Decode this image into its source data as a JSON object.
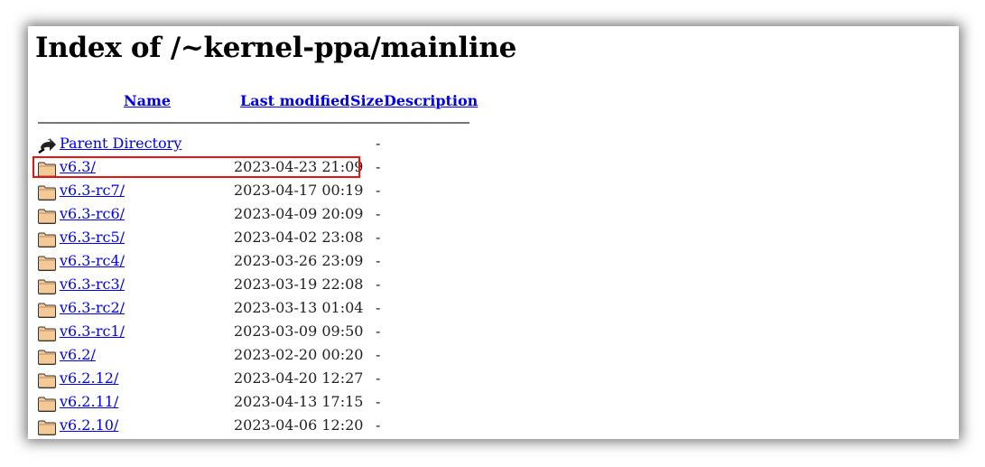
{
  "page": {
    "title": "Index of /~kernel-ppa/mainline"
  },
  "columns": {
    "name": "Name",
    "last_modified": "Last modified",
    "size": "Size",
    "description": "Description"
  },
  "parent": {
    "label": "Parent Directory",
    "size": "-",
    "icon": "back-arrow-icon"
  },
  "highlight_color": "#ee1111",
  "entries": [
    {
      "name": "v6.3/",
      "modified": "2023-04-23 21:09",
      "size": "-",
      "icon": "folder-icon",
      "highlighted": true
    },
    {
      "name": "v6.3-rc7/",
      "modified": "2023-04-17 00:19",
      "size": "-",
      "icon": "folder-icon"
    },
    {
      "name": "v6.3-rc6/",
      "modified": "2023-04-09 20:09",
      "size": "-",
      "icon": "folder-icon"
    },
    {
      "name": "v6.3-rc5/",
      "modified": "2023-04-02 23:08",
      "size": "-",
      "icon": "folder-icon"
    },
    {
      "name": "v6.3-rc4/",
      "modified": "2023-03-26 23:09",
      "size": "-",
      "icon": "folder-icon"
    },
    {
      "name": "v6.3-rc3/",
      "modified": "2023-03-19 22:08",
      "size": "-",
      "icon": "folder-icon"
    },
    {
      "name": "v6.3-rc2/",
      "modified": "2023-03-13 01:04",
      "size": "-",
      "icon": "folder-icon"
    },
    {
      "name": "v6.3-rc1/",
      "modified": "2023-03-09 09:50",
      "size": "-",
      "icon": "folder-icon"
    },
    {
      "name": "v6.2/",
      "modified": "2023-02-20 00:20",
      "size": "-",
      "icon": "folder-icon"
    },
    {
      "name": "v6.2.12/",
      "modified": "2023-04-20 12:27",
      "size": "-",
      "icon": "folder-icon"
    },
    {
      "name": "v6.2.11/",
      "modified": "2023-04-13 17:15",
      "size": "-",
      "icon": "folder-icon"
    },
    {
      "name": "v6.2.10/",
      "modified": "2023-04-06 12:20",
      "size": "-",
      "icon": "folder-icon"
    }
  ]
}
